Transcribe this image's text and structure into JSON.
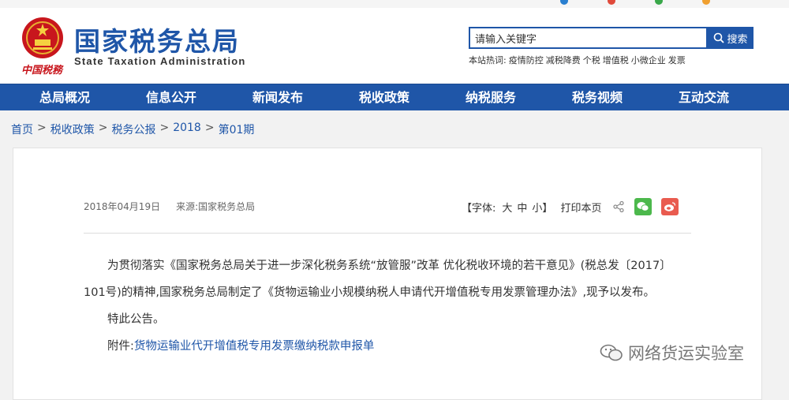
{
  "colors": {
    "brand_blue": "#1f56a8",
    "nav_bg": "#1f56a8",
    "wechat_green": "#4cb84c",
    "weibo_red": "#e95b4f",
    "link": "#1f56a8"
  },
  "header": {
    "logo_cn": "国家税务总局",
    "logo_en": "State Taxation Administration",
    "emblem_caption": "中国税務"
  },
  "search": {
    "placeholder": "请输入关键字",
    "button_label": "搜索",
    "hot_label": "本站热词:",
    "hot_terms": [
      "疫情防控",
      "减税降费",
      "个税",
      "增值税",
      "小微企业",
      "发票"
    ]
  },
  "nav": {
    "items": [
      "总局概况",
      "信息公开",
      "新闻发布",
      "税收政策",
      "纳税服务",
      "税务视频",
      "互动交流"
    ]
  },
  "breadcrumb": {
    "items": [
      "首页",
      "税收政策",
      "税务公报",
      "2018",
      "第01期"
    ],
    "separator": ">"
  },
  "article": {
    "date": "2018年04月19日",
    "source": "来源:国家税务总局",
    "font_label": "【字体:",
    "font_large": "大",
    "font_medium": "中",
    "font_small": "小】",
    "print_label": "打印本页",
    "paragraph1": "为贯彻落实《国家税务总局关于进一步深化税务系统“放管服”改革 优化税收环境的若干意见》(税总发〔2017〕101号)的精神,国家税务总局制定了《货物运输业小规模纳税人申请代开增值税专用发票管理办法》,现予以发布。",
    "paragraph2": "特此公告。",
    "attachment_label": "附件:",
    "attachment_link": "货物运输业代开增值税专用发票缴纳税款申报单"
  },
  "watermark": {
    "text": "网络货运实验室"
  }
}
